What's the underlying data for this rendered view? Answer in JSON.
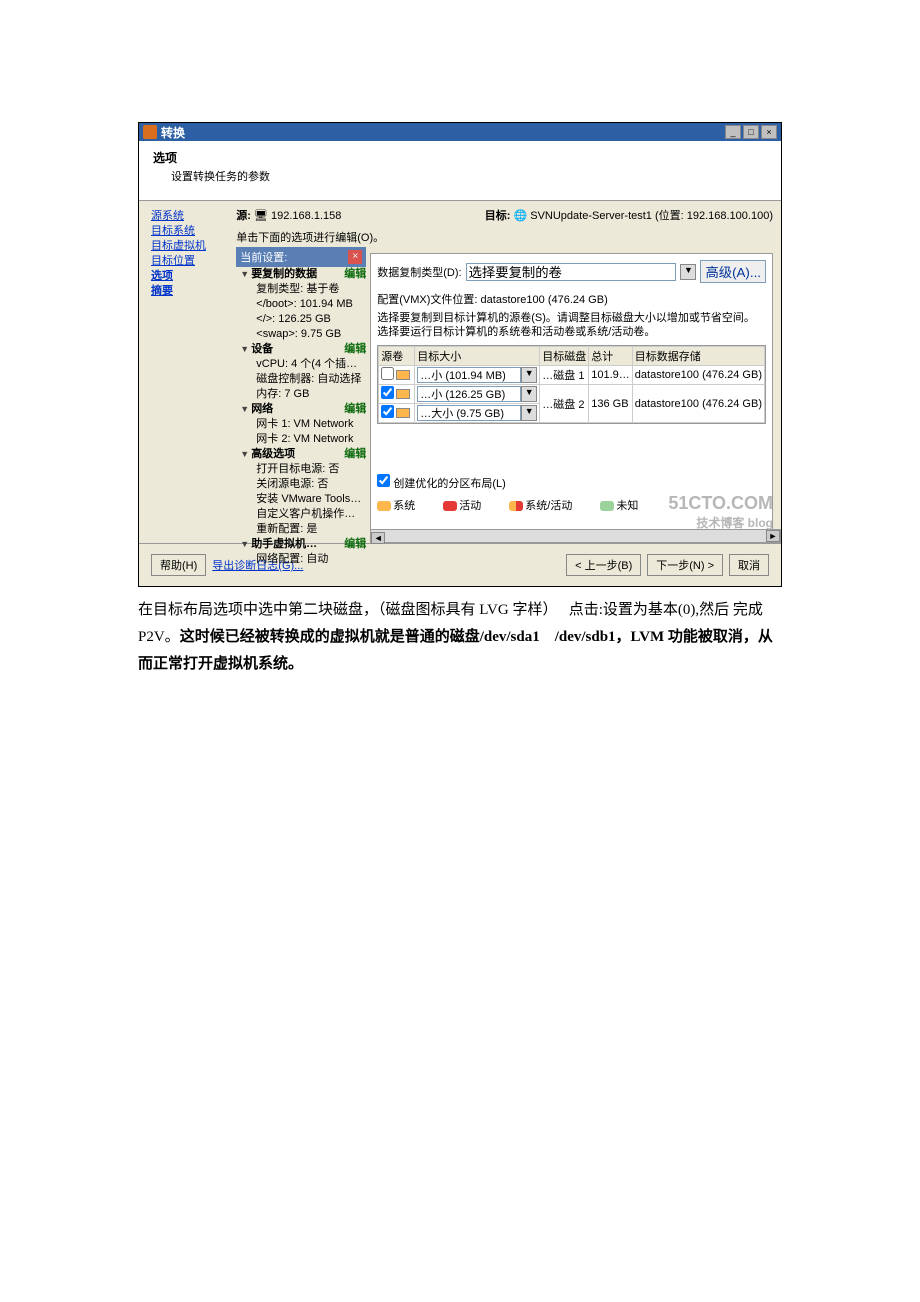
{
  "window": {
    "title": "转换",
    "minimize": "_",
    "restore": "□",
    "close": "×"
  },
  "header": {
    "title": "选项",
    "subtitle": "设置转换任务的参数"
  },
  "nav": {
    "items": [
      "源系统",
      "目标系统",
      "目标虚拟机",
      "目标位置",
      "选项",
      "摘要"
    ],
    "bold_index": 4
  },
  "srcdest": {
    "src_label": "源:",
    "src_value": "192.168.1.158",
    "dest_label": "目标:",
    "dest_value": "SVNUpdate-Server-test1 (位置: 192.168.100.100)"
  },
  "instruction": "单击下面的选项进行编辑(O)。",
  "settings": {
    "head": "当前设置:",
    "groups": [
      {
        "title": "要复制的数据",
        "edit": "编辑",
        "items": [
          "复制类型: 基于卷",
          "</boot>: 101.94 MB",
          "</>: 126.25 GB",
          "<swap>: 9.75 GB"
        ]
      },
      {
        "title": "设备",
        "edit": "编辑",
        "items": [
          "vCPU: 4 个(4 个插…",
          "磁盘控制器: 自动选择",
          "内存: 7 GB"
        ]
      },
      {
        "title": "网络",
        "edit": "编辑",
        "items": [
          "网卡 1: VM Network",
          "网卡 2: VM Network"
        ]
      },
      {
        "title": "高级选项",
        "edit": "编辑",
        "items": [
          "打开目标电源: 否",
          "关闭源电源: 否",
          "安装 VMware Tools…",
          "自定义客户机操作…",
          "重新配置: 是"
        ]
      },
      {
        "title": "助手虚拟机…",
        "edit": "编辑",
        "items": [
          "网络配置: 自动"
        ]
      }
    ]
  },
  "options_panel": {
    "type_label": "数据复制类型(D):",
    "type_value": "选择要复制的卷",
    "adv_btn": "高级(A)...",
    "cfg_line": "配置(VMX)文件位置: datastore100 (476.24 GB)",
    "help1": "选择要复制到目标计算机的源卷(S)。请调整目标磁盘大小以增加或节省空间。",
    "help2": "选择要运行目标计算机的系统卷和活动卷或系统/活动卷。",
    "headers": [
      "源卷",
      "目标大小",
      "目标磁盘",
      "总计",
      "目标数据存储"
    ],
    "rows": [
      {
        "chk": false,
        "size": "…小 (101.94 MB)",
        "disk": "…磁盘 1",
        "total": "101.9…",
        "store": "datastore100 (476.24 GB)",
        "rowspan": 1
      },
      {
        "chk": true,
        "size": "…小 (126.25 GB)",
        "disk": "…磁盘 2",
        "total": "136 GB",
        "store": "datastore100 (476.24 GB)",
        "rowspan": 2
      },
      {
        "chk": true,
        "size": "…大小 (9.75 GB)"
      }
    ],
    "layout_chk": "创建优化的分区布局(L)",
    "legend": {
      "sys": "系统",
      "act": "活动",
      "sysact": "系统/活动",
      "unk": "未知"
    }
  },
  "footer": {
    "help": "帮助(H)",
    "export": "导出诊断日志(G)...",
    "back": "< 上一步(B)",
    "next": "下一步(N) >",
    "cancel": "取消"
  },
  "watermark": {
    "line1": "51CTO.COM",
    "line2": "技术博客 blog"
  },
  "doc_text": {
    "p1a": "在目标布局选项中选中第二块磁盘，（磁盘图标具有 LVG 字样）　 点击:设置为基本(0),然后 完成 P2V。",
    "p1b": "这时候已经被转换成的虚拟机就是普通的磁盘/dev/sda1　/dev/sdb1，LVM 功能被取消，从而正常打开虚拟机系统。"
  }
}
